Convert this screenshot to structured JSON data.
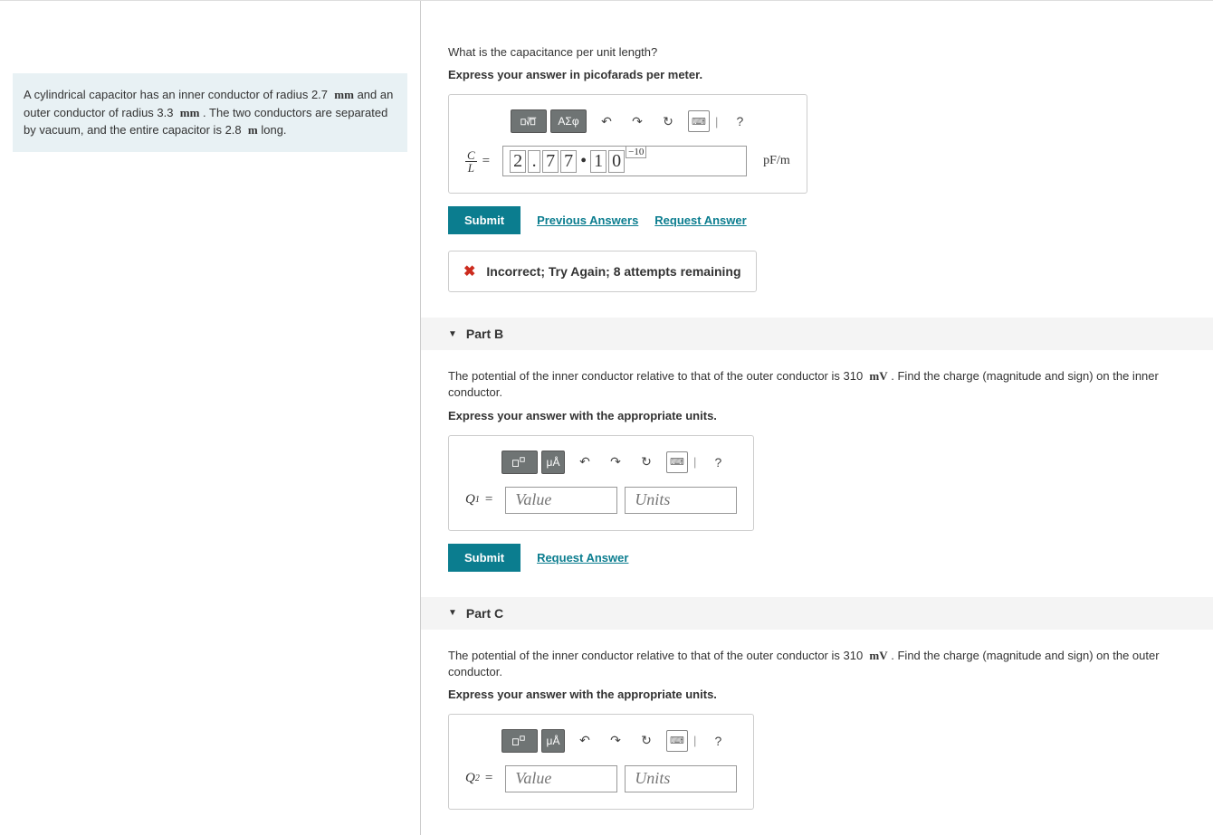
{
  "problem": {
    "text_prefix": "A cylindrical capacitor has an inner conductor of radius ",
    "r_inner": "2.7",
    "u1": "mm",
    "text_mid1": " and an outer conductor of radius ",
    "r_outer": "3.3",
    "u2": "mm",
    "text_mid2": ". The two conductors are separated by vacuum, and the entire capacitor is ",
    "length": "2.8",
    "u3": "m",
    "text_suffix": " long."
  },
  "partA": {
    "question": "What is the capacitance per unit length?",
    "instruction": "Express your answer in picofarads per meter.",
    "lhs_num": "C",
    "lhs_den": "L",
    "equals": "=",
    "entered": {
      "d1": "2",
      "dot": ".",
      "d2": "7",
      "d3": "7",
      "bullet": "•",
      "b1": "1",
      "b2": "0",
      "exp": "−10"
    },
    "unit": "pF/m",
    "submit": "Submit",
    "prev_answers": "Previous Answers",
    "request_answer": "Request Answer",
    "feedback": "Incorrect; Try Again; 8 attempts remaining",
    "tools": {
      "templates": "▭√▭",
      "symbols": "ΑΣφ",
      "undo": "↶",
      "redo": "↷",
      "reset": "↻",
      "keyboard": "⌨",
      "help": "?"
    }
  },
  "partB": {
    "header": "Part B",
    "question_prefix": "The potential of the inner conductor relative to that of the outer conductor is ",
    "voltage": "310",
    "vunit": "mV",
    "question_suffix": ". Find the charge (magnitude and sign) on the inner conductor.",
    "instruction": "Express your answer with the appropriate units.",
    "lhs_base": "Q",
    "lhs_sub": "1",
    "equals": "=",
    "value_placeholder": "Value",
    "units_placeholder": "Units",
    "submit": "Submit",
    "request_answer": "Request Answer",
    "tools": {
      "templates": "▭▭",
      "units": "μÅ",
      "undo": "↶",
      "redo": "↷",
      "reset": "↻",
      "keyboard": "⌨",
      "help": "?"
    }
  },
  "partC": {
    "header": "Part C",
    "question_prefix": "The potential of the inner conductor relative to that of the outer conductor is ",
    "voltage": "310",
    "vunit": "mV",
    "question_suffix": ". Find the charge (magnitude and sign) on the outer conductor.",
    "instruction": "Express your answer with the appropriate units.",
    "lhs_base": "Q",
    "lhs_sub": "2",
    "equals": "=",
    "value_placeholder": "Value",
    "units_placeholder": "Units",
    "tools": {
      "templates": "▭▭",
      "units": "μÅ",
      "undo": "↶",
      "redo": "↷",
      "reset": "↻",
      "keyboard": "⌨",
      "help": "?"
    }
  }
}
